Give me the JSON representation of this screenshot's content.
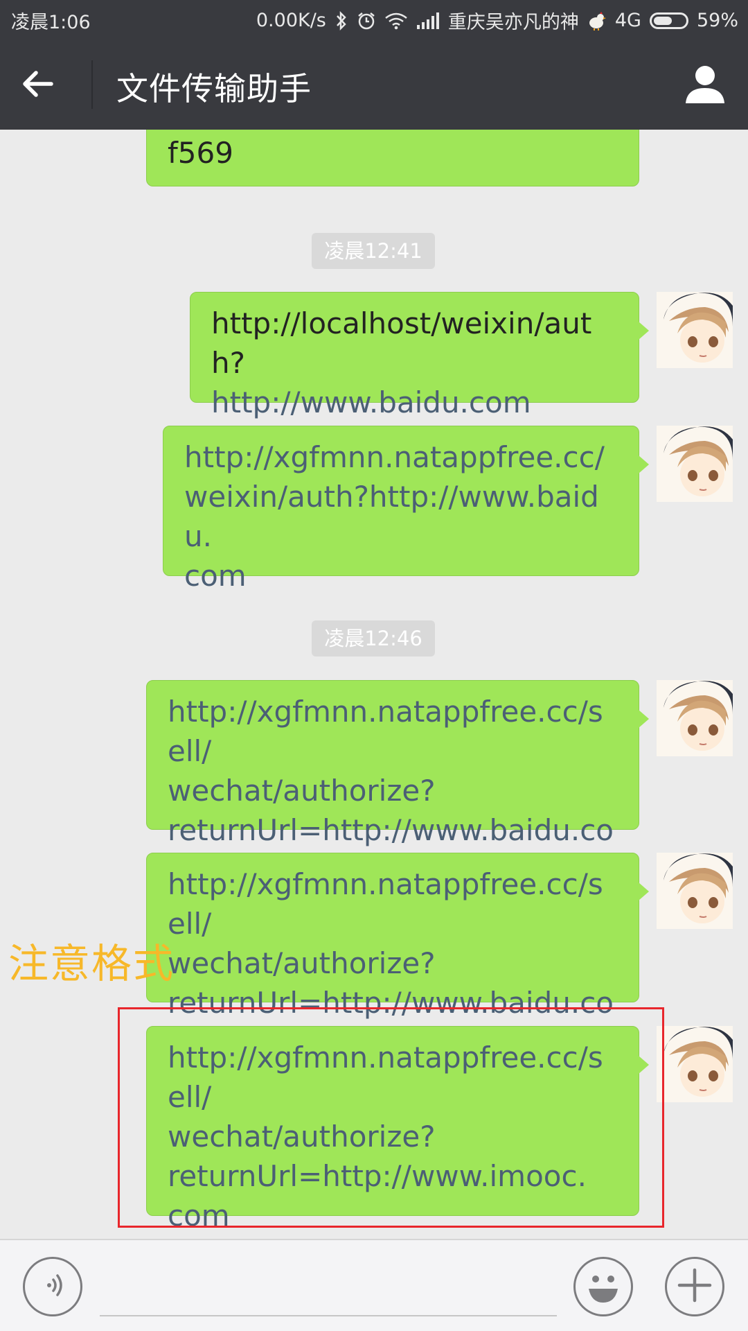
{
  "status_bar": {
    "time": "凌晨1:06",
    "net_speed": "0.00K/s",
    "carrier": "重庆吴亦凡的神",
    "network": "4G",
    "battery_percent": "59%",
    "battery_level": 0.59
  },
  "header": {
    "title": "文件传输助手",
    "back_icon": "arrow-left-icon",
    "profile_icon": "person-icon"
  },
  "messages": [
    {
      "lines": [
        "f569"
      ]
    },
    {
      "timestamp": "凌晨12:41"
    },
    {
      "lines": [
        "http://localhost/weixin/auth?",
        "http://www.baidu.com"
      ]
    },
    {
      "lines": [
        "http://xgfmnn.natappfree.cc/",
        "weixin/auth?http://www.baidu.",
        "com"
      ]
    },
    {
      "timestamp": "凌晨12:46"
    },
    {
      "lines": [
        "http://xgfmnn.natappfree.cc/sell/",
        "wechat/authorize?",
        "returnUrl=http://www.baidu.com"
      ]
    },
    {
      "lines": [
        "http://xgfmnn.natappfree.cc/sell/",
        "wechat/authorize?",
        "returnUrl=http://www.baidu.com"
      ]
    },
    {
      "lines": [
        "http://xgfmnn.natappfree.cc/sell/",
        "wechat/authorize?",
        "returnUrl=http://www.imooc.",
        "com"
      ]
    }
  ],
  "annotation": {
    "text": "注意格式",
    "color": "#f7b829",
    "box_color": "#e8262c"
  },
  "input_bar": {
    "voice_icon": "voice-icon",
    "emoji_icon": "smiley-icon",
    "more_icon": "plus-icon",
    "input_value": ""
  },
  "colors": {
    "bubble": "#9fe658",
    "header": "#393a3f",
    "background": "#ebebeb",
    "link": "#4b5f75"
  }
}
